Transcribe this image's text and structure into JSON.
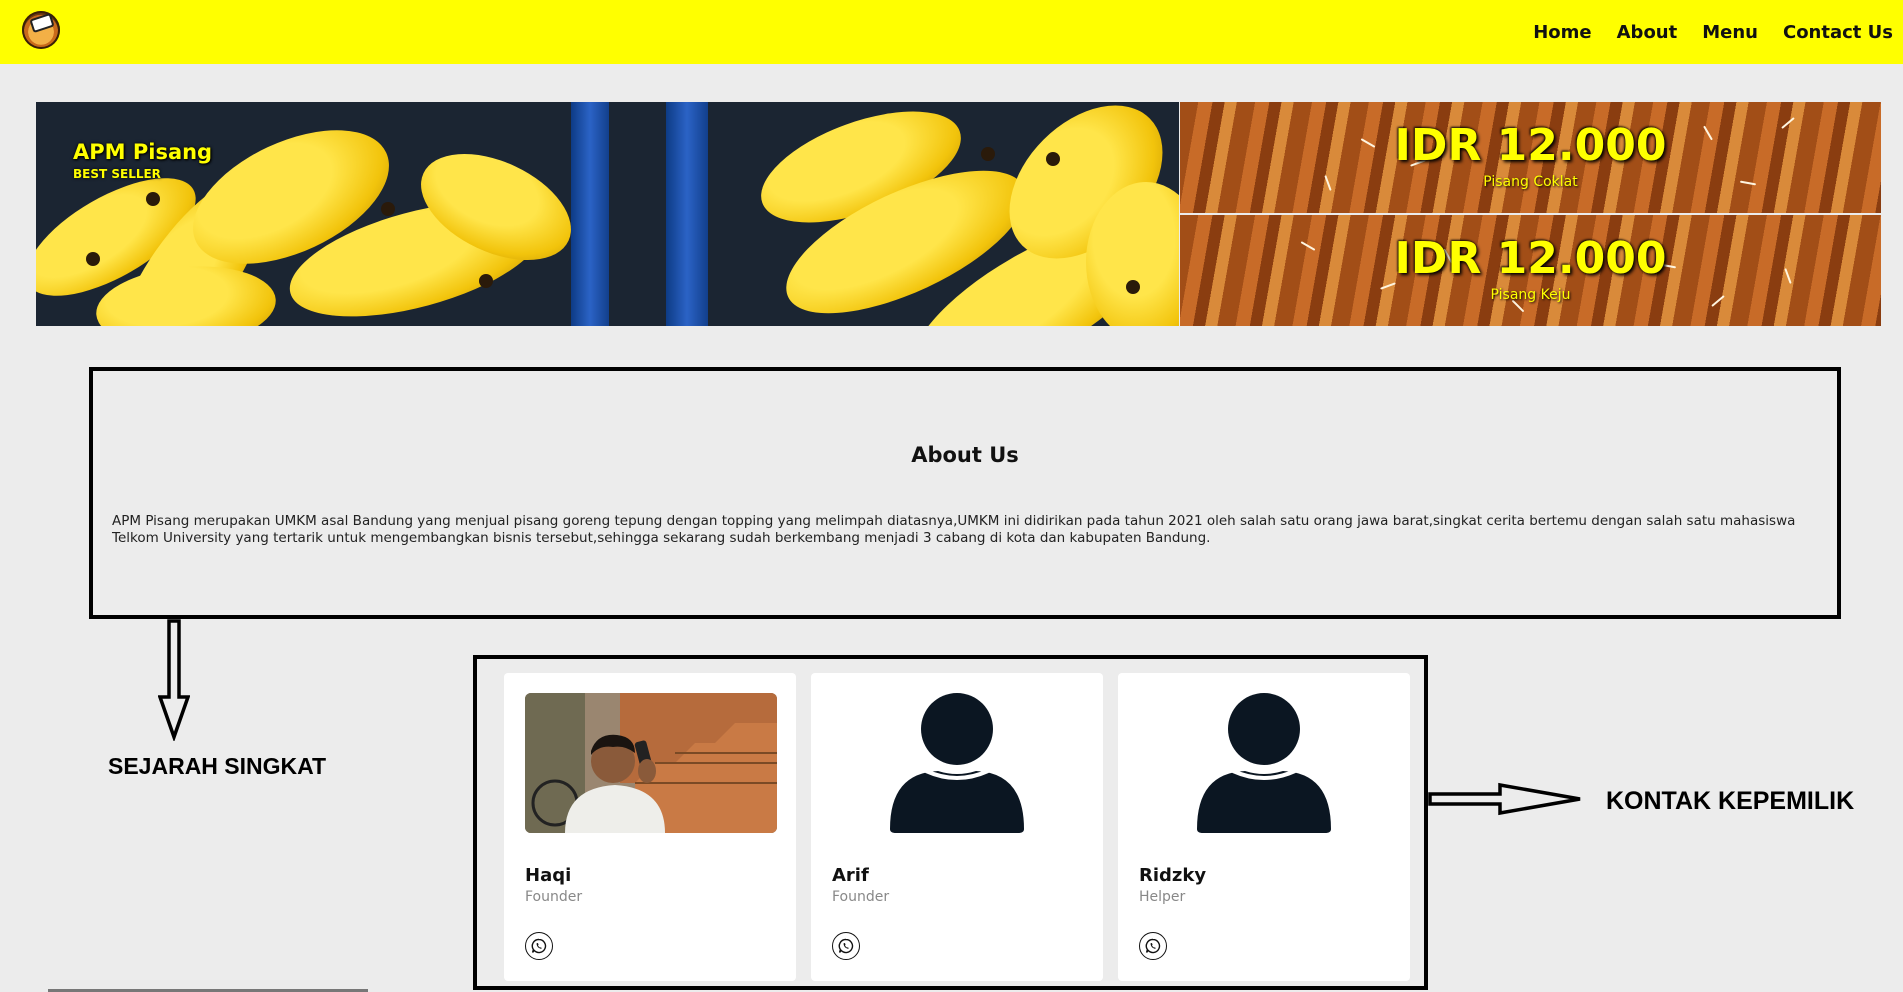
{
  "nav": {
    "links": [
      "Home",
      "About",
      "Menu",
      "Contact Us"
    ]
  },
  "hero": {
    "title": "APM Pisang",
    "subtitle": "BEST SELLER"
  },
  "prices": [
    {
      "value": "IDR 12.000",
      "name": "Pisang Coklat"
    },
    {
      "value": "IDR 12.000",
      "name": "Pisang Keju"
    }
  ],
  "about": {
    "title": "About Us",
    "text": "APM Pisang merupakan UMKM asal Bandung yang menjual pisang goreng tepung dengan topping yang melimpah diatasnya,UMKM ini didirikan pada tahun 2021 oleh salah satu orang jawa barat,singkat cerita bertemu dengan salah satu mahasiswa Telkom University yang tertarik untuk mengembangkan bisnis tersebut,sehingga sekarang sudah berkembang menjadi 3 cabang di kota dan kabupaten Bandung."
  },
  "annotations": {
    "left": "SEJARAH SINGKAT",
    "right": "KONTAK KEPEMILIK"
  },
  "team": [
    {
      "name": "Haqi",
      "role": "Founder",
      "avatar": "photo"
    },
    {
      "name": "Arif",
      "role": "Founder",
      "avatar": "user-icon"
    },
    {
      "name": "Ridzky",
      "role": "Helper",
      "avatar": "user-icon"
    }
  ],
  "colors": {
    "navbar": "#ffff00",
    "background": "#ececec",
    "price_text": "#ffff00",
    "avatar_icon": "#0b1622"
  }
}
